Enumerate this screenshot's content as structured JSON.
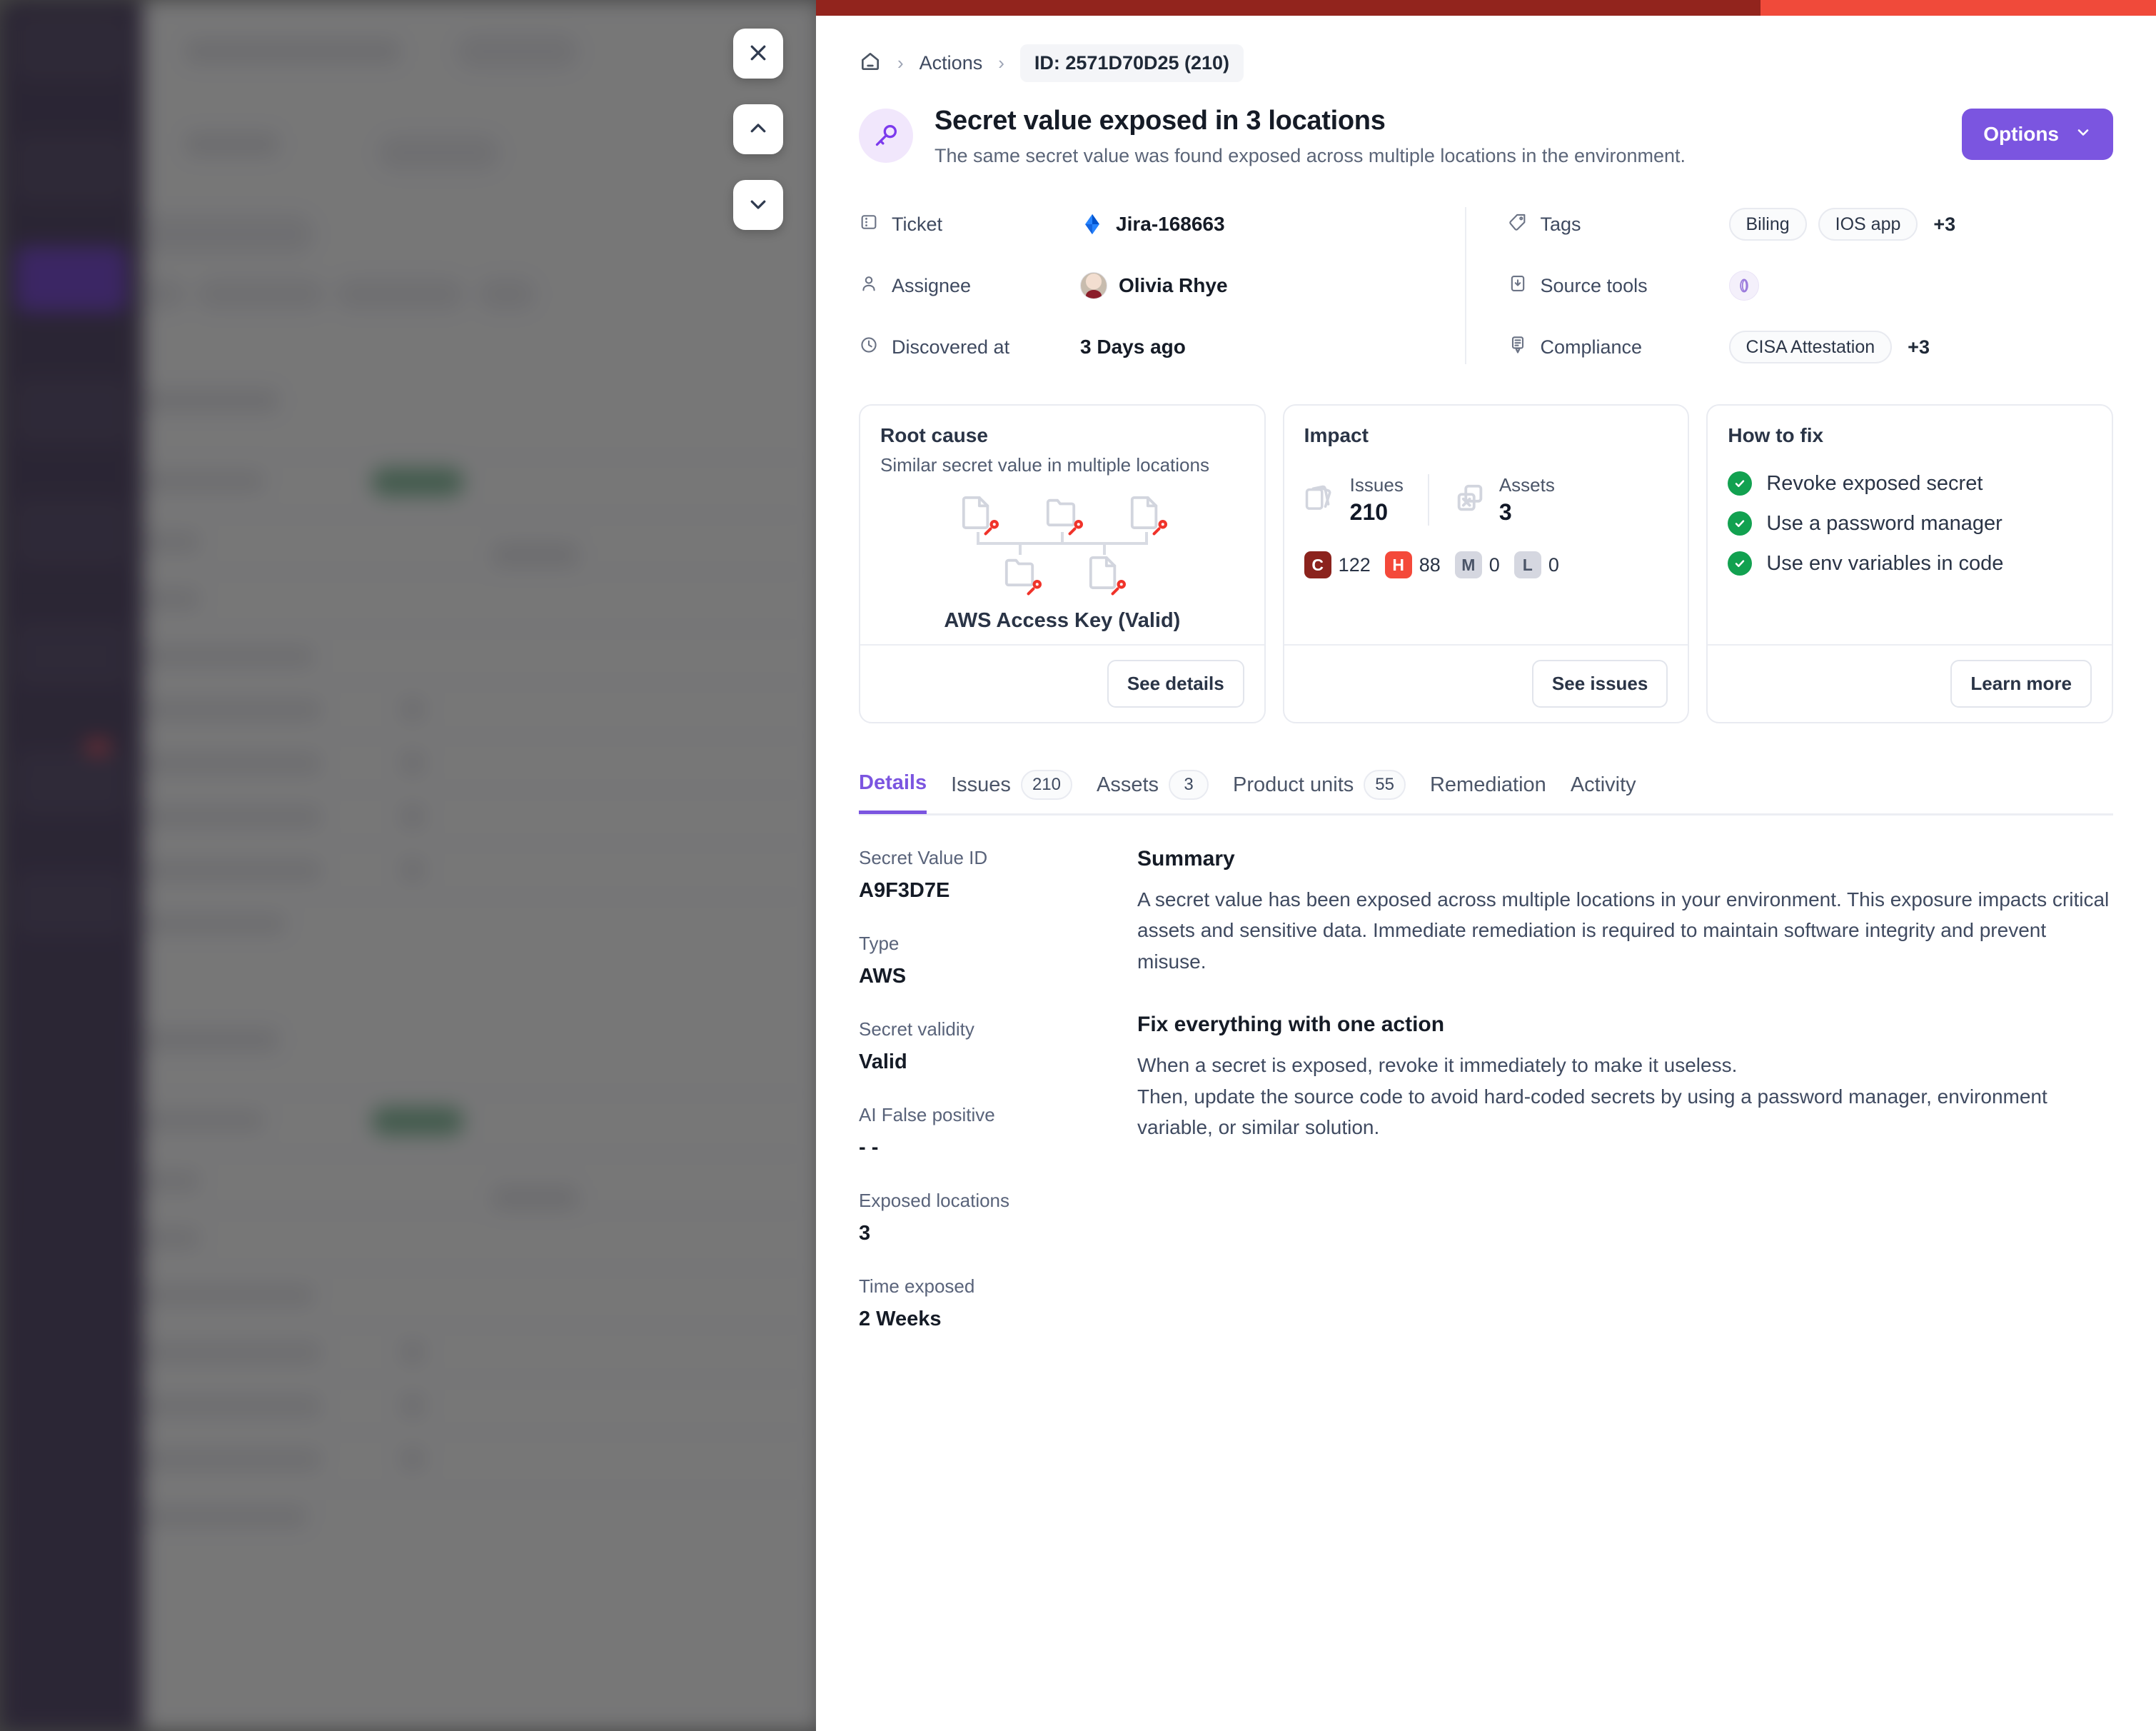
{
  "background": {
    "description": "dimmed blurred actions list app behind the drawer"
  },
  "floating_controls": [
    {
      "name": "close",
      "icon": "close-icon"
    },
    {
      "name": "previous",
      "icon": "chevron-up-icon"
    },
    {
      "name": "next",
      "icon": "chevron-down-icon"
    }
  ],
  "colors": {
    "severity_critical": "#8b231d",
    "severity_high": "#f4493a",
    "severity_medium": "#d5d7e0",
    "severity_low": "#d5d7e0",
    "accent_purple": "#7b55e0",
    "success_green": "#12a150",
    "strip_dark_red": "#92241d",
    "strip_bright_red": "#f04a3a"
  },
  "breadcrumb": {
    "home_icon": "home-icon",
    "separator": "›",
    "items": [
      {
        "label": "Actions"
      },
      {
        "label": "ID: 2571D70D25 (210)"
      }
    ]
  },
  "header": {
    "icon": "key-icon",
    "title": "Secret value exposed in 3 locations",
    "subtitle": "The same secret value was found exposed across multiple locations in the environment.",
    "options_label": "Options"
  },
  "meta": {
    "left": [
      {
        "icon": "ticket-icon",
        "label": "Ticket",
        "value": "Jira-168663",
        "value_icon": "jira-icon"
      },
      {
        "icon": "user-icon",
        "label": "Assignee",
        "value": "Olivia Rhye",
        "value_icon": "avatar"
      },
      {
        "icon": "clock-icon",
        "label": "Discovered at",
        "value": "3 Days ago"
      }
    ],
    "right": [
      {
        "icon": "tag-icon",
        "label": "Tags",
        "chips": [
          "Biling",
          "IOS app"
        ],
        "more": "+3"
      },
      {
        "icon": "source-tool-icon",
        "label": "Source tools",
        "chips": [],
        "more": ""
      },
      {
        "icon": "compliance-icon",
        "label": "Compliance",
        "chips": [
          "CISA Attestation"
        ],
        "more": "+3"
      }
    ]
  },
  "cards": {
    "root_cause": {
      "title": "Root cause",
      "subtitle": "Similar secret value in multiple locations",
      "diagram_label": "AWS Access Key (Valid)",
      "button": "See details"
    },
    "impact": {
      "title": "Impact",
      "stats": [
        {
          "icon": "issues-icon",
          "label": "Issues",
          "value": "210"
        },
        {
          "icon": "assets-icon",
          "label": "Assets",
          "value": "3"
        }
      ],
      "severities": [
        {
          "code": "C",
          "count": "122"
        },
        {
          "code": "H",
          "count": "88"
        },
        {
          "code": "M",
          "count": "0"
        },
        {
          "code": "L",
          "count": "0"
        }
      ],
      "button": "See issues"
    },
    "how_to_fix": {
      "title": "How to fix",
      "items": [
        "Revoke exposed secret",
        "Use a password manager",
        "Use env variables in code"
      ],
      "button": "Learn more"
    }
  },
  "tabs": [
    {
      "label": "Details",
      "count": "",
      "active": true
    },
    {
      "label": "Issues",
      "count": "210",
      "active": false
    },
    {
      "label": "Assets",
      "count": "3",
      "active": false
    },
    {
      "label": "Product units",
      "count": "55",
      "active": false
    },
    {
      "label": "Remediation",
      "count": "",
      "active": false
    },
    {
      "label": "Activity",
      "count": "",
      "active": false
    }
  ],
  "details": {
    "fields": [
      {
        "label": "Secret Value ID",
        "value": "A9F3D7E"
      },
      {
        "label": "Type",
        "value": "AWS"
      },
      {
        "label": "Secret validity",
        "value": "Valid"
      },
      {
        "label": "AI False positive",
        "value": "- -"
      },
      {
        "label": "Exposed locations",
        "value": "3"
      },
      {
        "label": "Time exposed",
        "value": "2 Weeks"
      }
    ],
    "summary_heading": "Summary",
    "summary_text": "A secret value has been exposed across multiple locations in your environment. This exposure impacts critical assets and sensitive data. Immediate remediation is required to maintain software integrity and prevent misuse.",
    "fix_heading": "Fix everything with one action",
    "fix_line_1": "When a secret is exposed, revoke it immediately to make it useless.",
    "fix_line_2": "Then, update the source code to avoid hard-coded secrets by using a password manager, environment variable, or similar solution."
  }
}
